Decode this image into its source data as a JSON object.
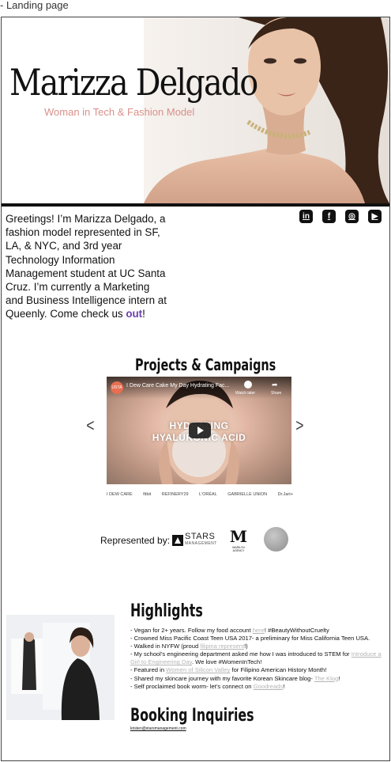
{
  "frame_label": "- Landing page",
  "hero": {
    "name": "Marizza Delgado",
    "subtitle": "Woman in Tech & Fashion Model"
  },
  "intro": {
    "text": "Greetings! I’m Marizza Delgado, a fashion model represented in SF, LA, & NYC, and 3rd year Technology Information Management student at UC Santa Cruz. I’m currently a Marketing and Business Intelligence intern at Queenly. Come check us ",
    "link": "out",
    "end": "!"
  },
  "social": [
    {
      "label": "in",
      "icon": "linkedin-icon"
    },
    {
      "label": "f",
      "icon": "facebook-icon"
    },
    {
      "label": "◎",
      "icon": "instagram-icon"
    },
    {
      "label": "▶",
      "icon": "youtube-icon"
    }
  ],
  "projects": {
    "title": "Projects & Campaigns",
    "video": {
      "channel": "USTA",
      "title": "I Dew Care Cake My Day Hydrating Fac...",
      "watch_later": "Watch later",
      "share": "Share",
      "caption_line1": "HYDRATING",
      "caption_line2": "HYALURONIC ACID"
    },
    "prev": "<",
    "next": ">",
    "brands": [
      "I DEW CARE",
      "fitbit",
      "REFINERY29",
      "L'ORÉAL",
      "GABRIELLE UNION",
      "Dr.Jart+"
    ]
  },
  "represented": {
    "label": "Represented by:",
    "stars": "STARS",
    "stars_sub": "MANAGEMENT",
    "m_mark": "M",
    "m_sub": "MARILYN AGENCY"
  },
  "highlights": {
    "title": "Highlights",
    "items": [
      {
        "pre": "Vegan for 2+ years. Follow my food account ",
        "link": "here",
        "post": "! #BeautyWithoutCruelty"
      },
      {
        "pre": "Crowned Miss Pacific Coast Teen USA 2017- a preliminary for Miss California Teen USA.",
        "link": "",
        "post": ""
      },
      {
        "pre": "Walked in NYFW (proud ",
        "link": "filipina represent",
        "post": "!)"
      },
      {
        "pre": "My school’s engineering department asked me how I was introduced to STEM for ",
        "link": "Introduce a Girl to Engineering Day",
        "post": ". We love #WomenInTech!"
      },
      {
        "pre": "Featured in ",
        "link": "Women of Silicon Valley",
        "post": " for Filipino American History Month!"
      },
      {
        "pre": "Shared my skincare journey with my favorite Korean Skincare blog- ",
        "link": "The Klog",
        "post": "!"
      },
      {
        "pre": "Self proclaimed book worm- let’s connect on ",
        "link": "Goodreads",
        "post": "!"
      }
    ]
  },
  "booking": {
    "title": "Booking Inquiries",
    "email": "kristen@starsmanagement.com"
  }
}
